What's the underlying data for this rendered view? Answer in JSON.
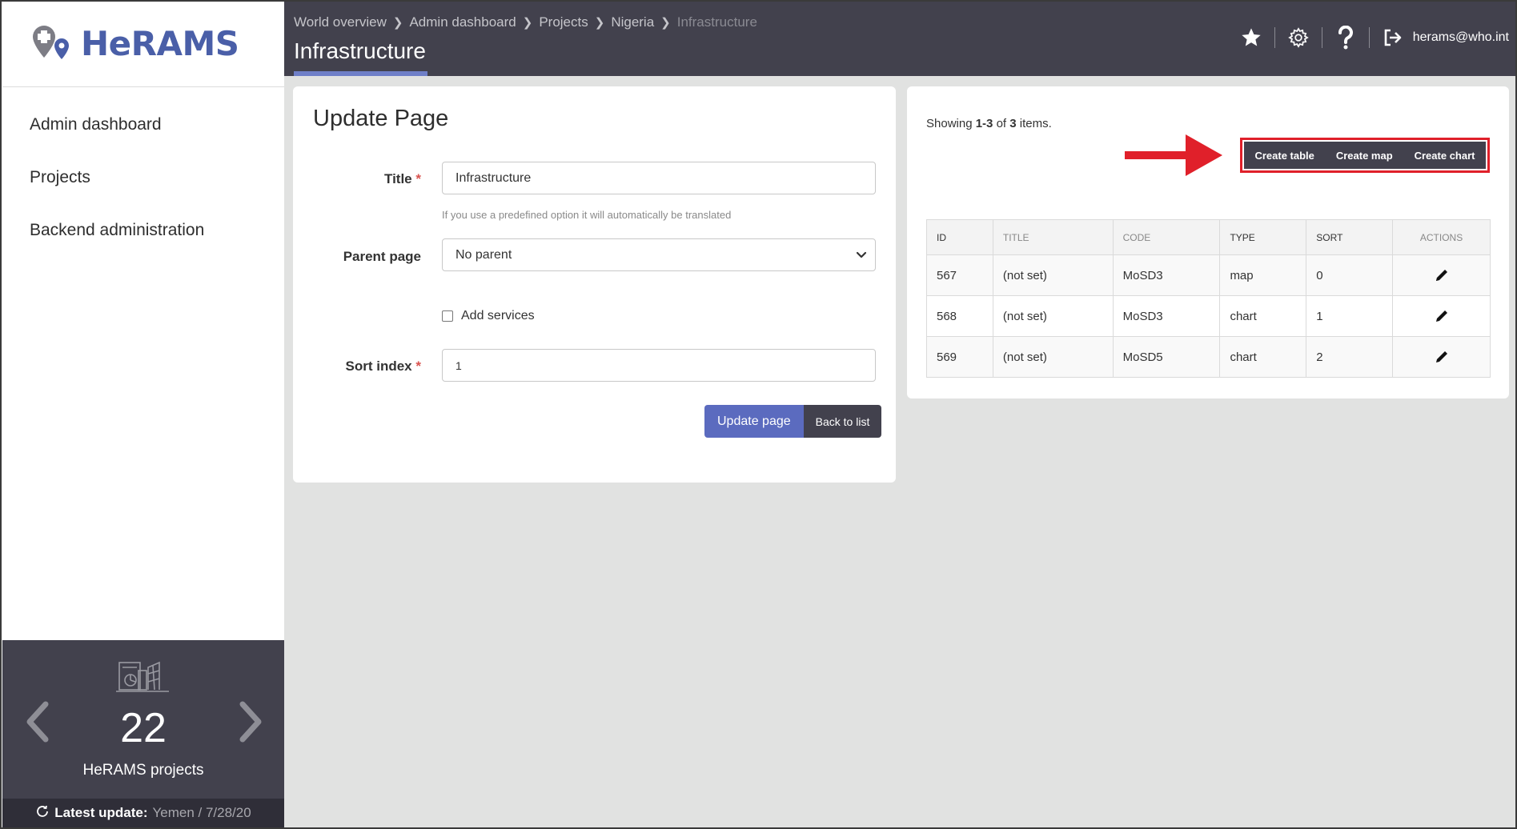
{
  "app": {
    "logo_text": "HeRAMS"
  },
  "sidebar": {
    "items": [
      {
        "label": "Admin dashboard"
      },
      {
        "label": "Projects"
      },
      {
        "label": "Backend administration"
      }
    ],
    "stats": {
      "count": "22",
      "label": "HeRAMS projects",
      "latest_label": "Latest update:",
      "latest_value": "Yemen / 7/28/20"
    }
  },
  "header": {
    "breadcrumb": [
      "World overview",
      "Admin dashboard",
      "Projects",
      "Nigeria",
      "Infrastructure"
    ],
    "title": "Infrastructure",
    "user_email": "herams@who.int",
    "icons": [
      "star-icon",
      "gear-icon",
      "help-icon",
      "logout-icon"
    ]
  },
  "form": {
    "heading": "Update Page",
    "title_label": "Title",
    "title_required": "*",
    "title_value": "Infrastructure",
    "title_hint": "If you use a predefined option it will automatically be translated",
    "parent_label": "Parent page",
    "parent_value": "No parent",
    "add_services_label": "Add services",
    "sort_label": "Sort index",
    "sort_required": "*",
    "sort_value": "1",
    "update_button": "Update page",
    "back_button": "Back to list"
  },
  "list": {
    "showing_prefix": "Showing ",
    "showing_range": "1-3",
    "showing_of": " of ",
    "showing_total": "3",
    "showing_suffix": " items.",
    "buttons": {
      "create_table": "Create table",
      "create_map": "Create map",
      "create_chart": "Create chart"
    },
    "columns": [
      "ID",
      "TITLE",
      "CODE",
      "TYPE",
      "SORT",
      "ACTIONS"
    ],
    "rows": [
      {
        "id": "567",
        "title": "(not set)",
        "code": "MoSD3",
        "type": "map",
        "sort": "0"
      },
      {
        "id": "568",
        "title": "(not set)",
        "code": "MoSD3",
        "type": "chart",
        "sort": "1"
      },
      {
        "id": "569",
        "title": "(not set)",
        "code": "MoSD5",
        "type": "chart",
        "sort": "2"
      }
    ]
  },
  "colors": {
    "sidebar_dark": "#42414d",
    "accent": "#5b6bbf",
    "highlight": "#e0202a",
    "background": "#e1e2e1"
  }
}
